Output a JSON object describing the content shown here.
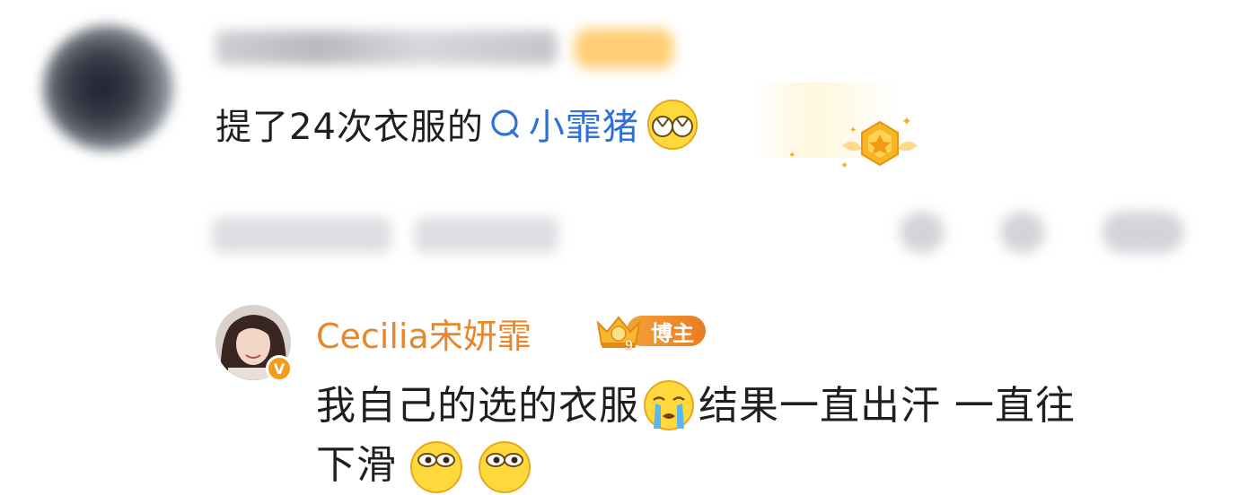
{
  "top_comment": {
    "text_prefix": "提了24次衣服的",
    "topic_link": "小霏猪"
  },
  "reply": {
    "author": "Cecilia宋妍霏",
    "badge_label": "博主",
    "badge_level": "9",
    "text_line1": "我自己的选的衣服",
    "text_line1_cont": "结果一直出汗 一直往",
    "text_line2": "下滑"
  },
  "colors": {
    "link": "#2f6fd8",
    "author": "#e8872a",
    "badge": "#e97c1f",
    "verified": "#f59b1a"
  },
  "icons": [
    "search-icon",
    "cover-eyes-emoji-icon",
    "medal-icon",
    "crown-icon",
    "verified-icon",
    "crying-emoji-icon",
    "eyes-emoji-icon"
  ]
}
